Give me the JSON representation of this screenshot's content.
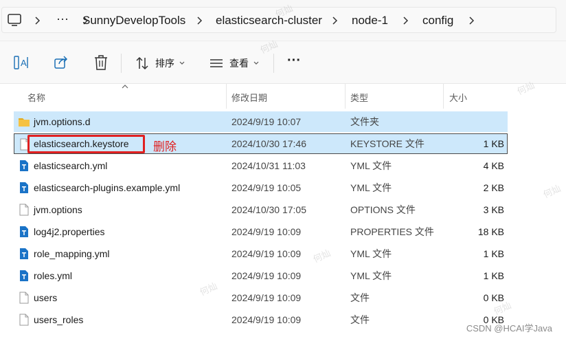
{
  "breadcrumb": {
    "items": [
      "SunnyDevelopTools",
      "elasticsearch-cluster",
      "node-1",
      "config"
    ],
    "more": "···"
  },
  "commandbar": {
    "sort_label": "排序",
    "view_label": "查看",
    "more": "···"
  },
  "columns": {
    "name": "名称",
    "date": "修改日期",
    "type": "类型",
    "size": "大小"
  },
  "files": [
    {
      "name": "jvm.options.d",
      "date": "2024/9/19 10:07",
      "type": "文件夹",
      "size": "",
      "icon": "folder-icon"
    },
    {
      "name": "elasticsearch.keystore",
      "date": "2024/10/30 17:46",
      "type": "KEYSTORE 文件",
      "size": "1 KB",
      "icon": "file-icon"
    },
    {
      "name": "elasticsearch.yml",
      "date": "2024/10/31 11:03",
      "type": "YML 文件",
      "size": "4 KB",
      "icon": "text-file-icon"
    },
    {
      "name": "elasticsearch-plugins.example.yml",
      "date": "2024/9/19 10:05",
      "type": "YML 文件",
      "size": "2 KB",
      "icon": "text-file-icon"
    },
    {
      "name": "jvm.options",
      "date": "2024/10/30 17:05",
      "type": "OPTIONS 文件",
      "size": "3 KB",
      "icon": "file-icon"
    },
    {
      "name": "log4j2.properties",
      "date": "2024/9/19 10:09",
      "type": "PROPERTIES 文件",
      "size": "18 KB",
      "icon": "text-file-icon"
    },
    {
      "name": "role_mapping.yml",
      "date": "2024/9/19 10:09",
      "type": "YML 文件",
      "size": "1 KB",
      "icon": "text-file-icon"
    },
    {
      "name": "roles.yml",
      "date": "2024/9/19 10:09",
      "type": "YML 文件",
      "size": "1 KB",
      "icon": "text-file-icon"
    },
    {
      "name": "users",
      "date": "2024/9/19 10:09",
      "type": "文件",
      "size": "0 KB",
      "icon": "file-icon"
    },
    {
      "name": "users_roles",
      "date": "2024/9/19 10:09",
      "type": "文件",
      "size": "0 KB",
      "icon": "file-icon"
    }
  ],
  "annotation": {
    "text": "删除",
    "color": "#e02020"
  },
  "watermark": {
    "text": "何灿",
    "footer": "CSDN @HCAI学Java"
  },
  "colors": {
    "selection": "#cde8fb",
    "folder": "#f5c242",
    "text_file_accent": "#1a73c7"
  }
}
